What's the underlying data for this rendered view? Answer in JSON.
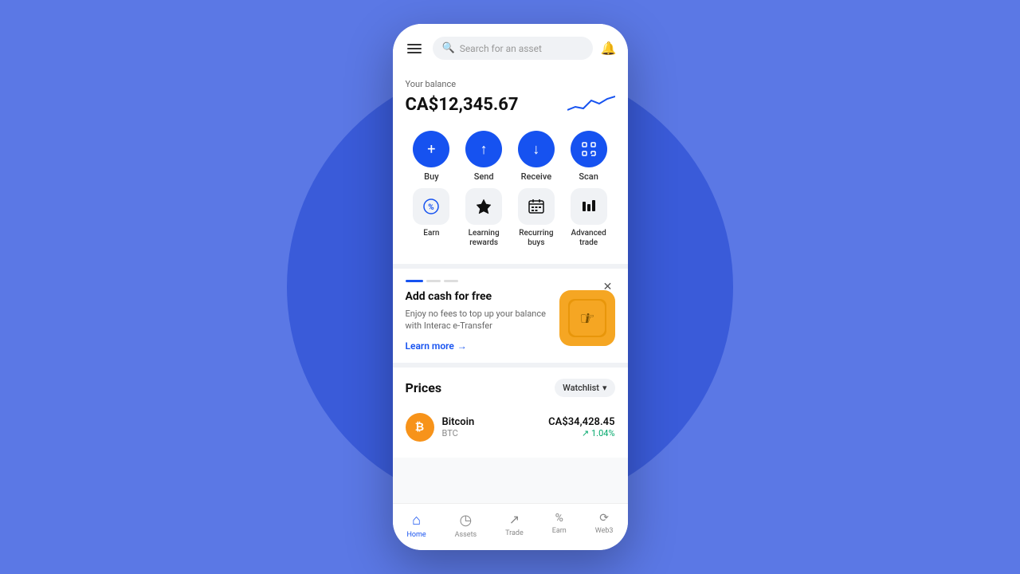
{
  "background": {
    "color": "#5b78e5",
    "circle_color": "#3a5bd9"
  },
  "header": {
    "search_placeholder": "Search for an asset",
    "menu_label": "menu",
    "bell_label": "notifications"
  },
  "balance": {
    "label": "Your balance",
    "amount": "CA$12,345.67"
  },
  "actions_row1": [
    {
      "id": "buy",
      "label": "Buy",
      "icon": "+"
    },
    {
      "id": "send",
      "label": "Send",
      "icon": "↑"
    },
    {
      "id": "receive",
      "label": "Receive",
      "icon": "↓"
    },
    {
      "id": "scan",
      "label": "Scan",
      "icon": "⊡"
    }
  ],
  "actions_row2": [
    {
      "id": "earn",
      "label": "Earn",
      "icon": "%"
    },
    {
      "id": "learning",
      "label": "Learning rewards",
      "icon": "◆"
    },
    {
      "id": "recurring",
      "label": "Recurring buys",
      "icon": "▦"
    },
    {
      "id": "advanced",
      "label": "Advanced trade",
      "icon": "▮▮"
    }
  ],
  "promo": {
    "title": "Add cash for free",
    "description": "Enjoy no fees to top up your balance with Interac e-Transfer",
    "link_label": "Learn more",
    "dots": [
      {
        "active": true
      },
      {
        "active": false
      },
      {
        "active": false
      }
    ]
  },
  "prices": {
    "title": "Prices",
    "watchlist_label": "Watchlist",
    "assets": [
      {
        "name": "Bitcoin",
        "ticker": "BTC",
        "price": "CA$34,428.45",
        "change": "↗ 1.04%",
        "icon_letter": "₿",
        "icon_color": "#f7931a"
      }
    ]
  },
  "bottom_nav": [
    {
      "id": "home",
      "label": "Home",
      "icon": "⌂",
      "active": true
    },
    {
      "id": "assets",
      "label": "Assets",
      "icon": "◷",
      "active": false
    },
    {
      "id": "trade",
      "label": "Trade",
      "icon": "↗",
      "active": false
    },
    {
      "id": "earn",
      "label": "Earn",
      "icon": "%",
      "active": false
    },
    {
      "id": "web3",
      "label": "Web3",
      "icon": "⟳",
      "active": false
    }
  ]
}
